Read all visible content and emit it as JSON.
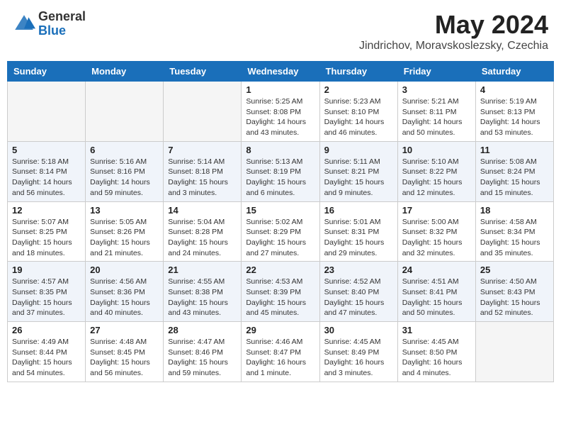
{
  "header": {
    "logo_general": "General",
    "logo_blue": "Blue",
    "month_title": "May 2024",
    "location": "Jindrichov, Moravskoslezsky, Czechia"
  },
  "weekdays": [
    "Sunday",
    "Monday",
    "Tuesday",
    "Wednesday",
    "Thursday",
    "Friday",
    "Saturday"
  ],
  "weeks": [
    [
      {
        "day": "",
        "info": ""
      },
      {
        "day": "",
        "info": ""
      },
      {
        "day": "",
        "info": ""
      },
      {
        "day": "1",
        "info": "Sunrise: 5:25 AM\nSunset: 8:08 PM\nDaylight: 14 hours\nand 43 minutes."
      },
      {
        "day": "2",
        "info": "Sunrise: 5:23 AM\nSunset: 8:10 PM\nDaylight: 14 hours\nand 46 minutes."
      },
      {
        "day": "3",
        "info": "Sunrise: 5:21 AM\nSunset: 8:11 PM\nDaylight: 14 hours\nand 50 minutes."
      },
      {
        "day": "4",
        "info": "Sunrise: 5:19 AM\nSunset: 8:13 PM\nDaylight: 14 hours\nand 53 minutes."
      }
    ],
    [
      {
        "day": "5",
        "info": "Sunrise: 5:18 AM\nSunset: 8:14 PM\nDaylight: 14 hours\nand 56 minutes."
      },
      {
        "day": "6",
        "info": "Sunrise: 5:16 AM\nSunset: 8:16 PM\nDaylight: 14 hours\nand 59 minutes."
      },
      {
        "day": "7",
        "info": "Sunrise: 5:14 AM\nSunset: 8:18 PM\nDaylight: 15 hours\nand 3 minutes."
      },
      {
        "day": "8",
        "info": "Sunrise: 5:13 AM\nSunset: 8:19 PM\nDaylight: 15 hours\nand 6 minutes."
      },
      {
        "day": "9",
        "info": "Sunrise: 5:11 AM\nSunset: 8:21 PM\nDaylight: 15 hours\nand 9 minutes."
      },
      {
        "day": "10",
        "info": "Sunrise: 5:10 AM\nSunset: 8:22 PM\nDaylight: 15 hours\nand 12 minutes."
      },
      {
        "day": "11",
        "info": "Sunrise: 5:08 AM\nSunset: 8:24 PM\nDaylight: 15 hours\nand 15 minutes."
      }
    ],
    [
      {
        "day": "12",
        "info": "Sunrise: 5:07 AM\nSunset: 8:25 PM\nDaylight: 15 hours\nand 18 minutes."
      },
      {
        "day": "13",
        "info": "Sunrise: 5:05 AM\nSunset: 8:26 PM\nDaylight: 15 hours\nand 21 minutes."
      },
      {
        "day": "14",
        "info": "Sunrise: 5:04 AM\nSunset: 8:28 PM\nDaylight: 15 hours\nand 24 minutes."
      },
      {
        "day": "15",
        "info": "Sunrise: 5:02 AM\nSunset: 8:29 PM\nDaylight: 15 hours\nand 27 minutes."
      },
      {
        "day": "16",
        "info": "Sunrise: 5:01 AM\nSunset: 8:31 PM\nDaylight: 15 hours\nand 29 minutes."
      },
      {
        "day": "17",
        "info": "Sunrise: 5:00 AM\nSunset: 8:32 PM\nDaylight: 15 hours\nand 32 minutes."
      },
      {
        "day": "18",
        "info": "Sunrise: 4:58 AM\nSunset: 8:34 PM\nDaylight: 15 hours\nand 35 minutes."
      }
    ],
    [
      {
        "day": "19",
        "info": "Sunrise: 4:57 AM\nSunset: 8:35 PM\nDaylight: 15 hours\nand 37 minutes."
      },
      {
        "day": "20",
        "info": "Sunrise: 4:56 AM\nSunset: 8:36 PM\nDaylight: 15 hours\nand 40 minutes."
      },
      {
        "day": "21",
        "info": "Sunrise: 4:55 AM\nSunset: 8:38 PM\nDaylight: 15 hours\nand 43 minutes."
      },
      {
        "day": "22",
        "info": "Sunrise: 4:53 AM\nSunset: 8:39 PM\nDaylight: 15 hours\nand 45 minutes."
      },
      {
        "day": "23",
        "info": "Sunrise: 4:52 AM\nSunset: 8:40 PM\nDaylight: 15 hours\nand 47 minutes."
      },
      {
        "day": "24",
        "info": "Sunrise: 4:51 AM\nSunset: 8:41 PM\nDaylight: 15 hours\nand 50 minutes."
      },
      {
        "day": "25",
        "info": "Sunrise: 4:50 AM\nSunset: 8:43 PM\nDaylight: 15 hours\nand 52 minutes."
      }
    ],
    [
      {
        "day": "26",
        "info": "Sunrise: 4:49 AM\nSunset: 8:44 PM\nDaylight: 15 hours\nand 54 minutes."
      },
      {
        "day": "27",
        "info": "Sunrise: 4:48 AM\nSunset: 8:45 PM\nDaylight: 15 hours\nand 56 minutes."
      },
      {
        "day": "28",
        "info": "Sunrise: 4:47 AM\nSunset: 8:46 PM\nDaylight: 15 hours\nand 59 minutes."
      },
      {
        "day": "29",
        "info": "Sunrise: 4:46 AM\nSunset: 8:47 PM\nDaylight: 16 hours\nand 1 minute."
      },
      {
        "day": "30",
        "info": "Sunrise: 4:45 AM\nSunset: 8:49 PM\nDaylight: 16 hours\nand 3 minutes."
      },
      {
        "day": "31",
        "info": "Sunrise: 4:45 AM\nSunset: 8:50 PM\nDaylight: 16 hours\nand 4 minutes."
      },
      {
        "day": "",
        "info": ""
      }
    ]
  ]
}
